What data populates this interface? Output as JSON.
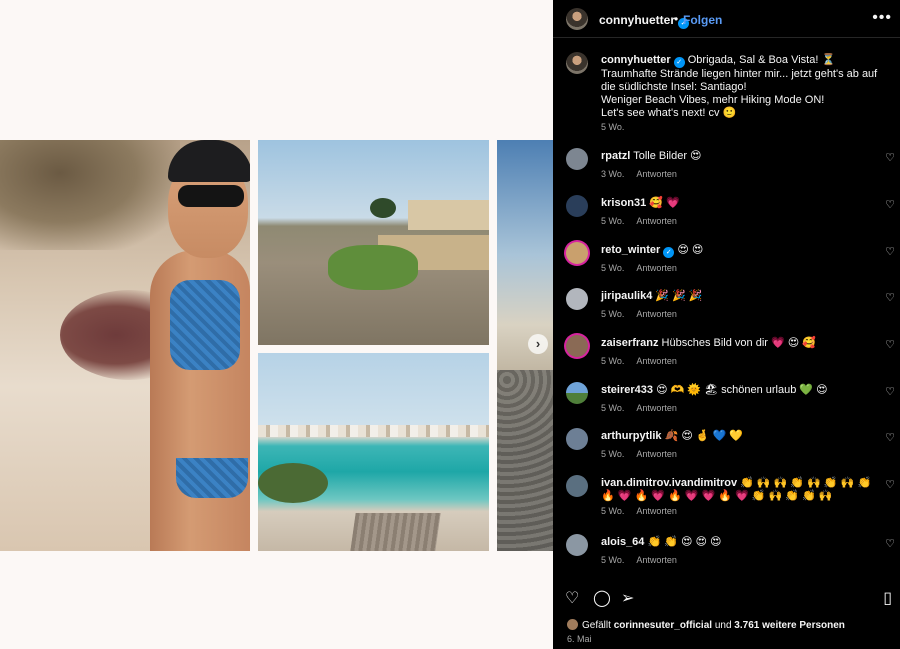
{
  "post": {
    "username": "connyhuetter",
    "follow_label": "Folgen",
    "dot": "•",
    "more_icon": "more-horizontal-icon",
    "caption": "Obrigada, Sal & Boa Vista! ⏳",
    "caption_lines": [
      "Traumhafte Strände liegen hinter mir... jetzt geht's ab auf die südlichste Insel: Santiago!",
      "Weniger Beach Vibes, mehr Hiking Mode ON!",
      "Let's see what's next! cv 🙂"
    ],
    "caption_time": "5 Wo."
  },
  "comments": [
    {
      "user": "rpatzl",
      "text": "Tolle Bilder 😍",
      "time": "3 Wo.",
      "reply": "Antworten"
    },
    {
      "user": "krison31",
      "text": "🥰 💗",
      "time": "5 Wo.",
      "reply": "Antworten"
    },
    {
      "user": "reto_winter",
      "verified": "✓",
      "text": "😍 😍",
      "time": "5 Wo.",
      "reply": "Antworten"
    },
    {
      "user": "jiripaulik4",
      "text": "🎉 🎉 🎉",
      "time": "5 Wo.",
      "reply": "Antworten"
    },
    {
      "user": "zaiserfranz",
      "text": "Hübsches Bild von dir 💗 😍 🥰",
      "time": "5 Wo.",
      "reply": "Antworten"
    },
    {
      "user": "steirer433",
      "text": "😍 🫶 🌞 🏖 schönen urlaub 💚 😍",
      "time": "5 Wo.",
      "reply": "Antworten"
    },
    {
      "user": "arthurpytlik",
      "text": "🍂 😍 🤞 💙 💛",
      "time": "5 Wo.",
      "reply": "Antworten"
    },
    {
      "user": "ivan.dimitrov.ivandimitrov",
      "text": "👏 🙌 🙌 👏 🙌 👏 🙌 👏 🔥 💗 🔥 💗 🔥 💗 💗 🔥 💗 👏 🙌 👏 👏 🙌",
      "time": "5 Wo.",
      "reply": "Antworten"
    },
    {
      "user": "alois_64",
      "text": "👏 👏 😍 😍 😍",
      "time": "5 Wo.",
      "reply": "Antworten"
    }
  ],
  "actions": {
    "like_icon": "heart-icon",
    "comment_icon": "comment-icon",
    "share_icon": "share-icon",
    "save_icon": "bookmark-icon"
  },
  "likes": {
    "prefix": "Gefällt",
    "user": "corinnesuter_official",
    "middle": "und",
    "count": "3.761 weitere Personen"
  },
  "date": "6. Mai",
  "colors": {
    "panel_bg": "#000000",
    "link_blue": "#5a9bf5",
    "verified_blue": "#0095f6",
    "meta_gray": "#a8a8a8"
  }
}
